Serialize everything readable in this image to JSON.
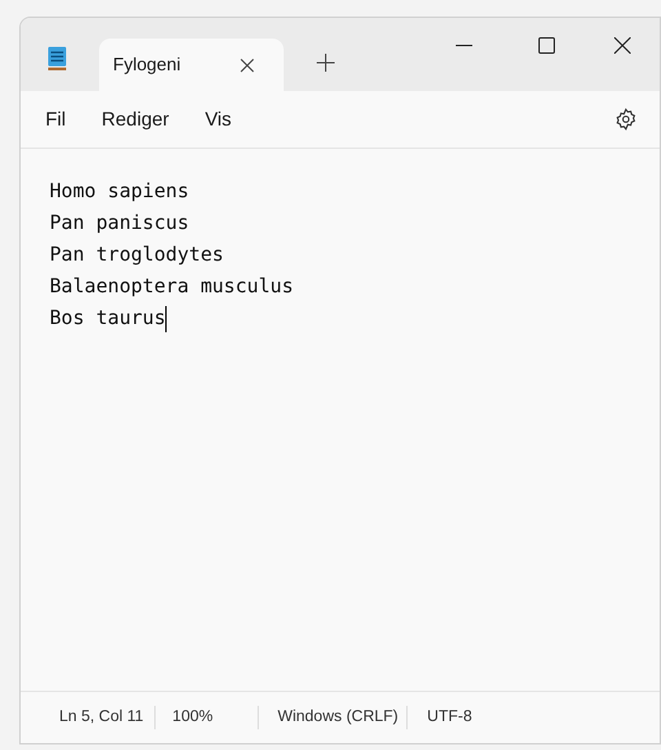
{
  "tab": {
    "title": "Fylogeni",
    "selected": true
  },
  "menu": [
    "Fil",
    "Rediger",
    "Vis"
  ],
  "editor": {
    "lines": [
      "Homo sapiens",
      "Pan paniscus",
      "Pan troglodytes",
      "Balaenoptera musculus",
      "Bos taurus"
    ]
  },
  "status_bar": [
    "Ln 5, Col 11",
    "100%",
    "Windows (CRLF)",
    "UTF-8"
  ]
}
